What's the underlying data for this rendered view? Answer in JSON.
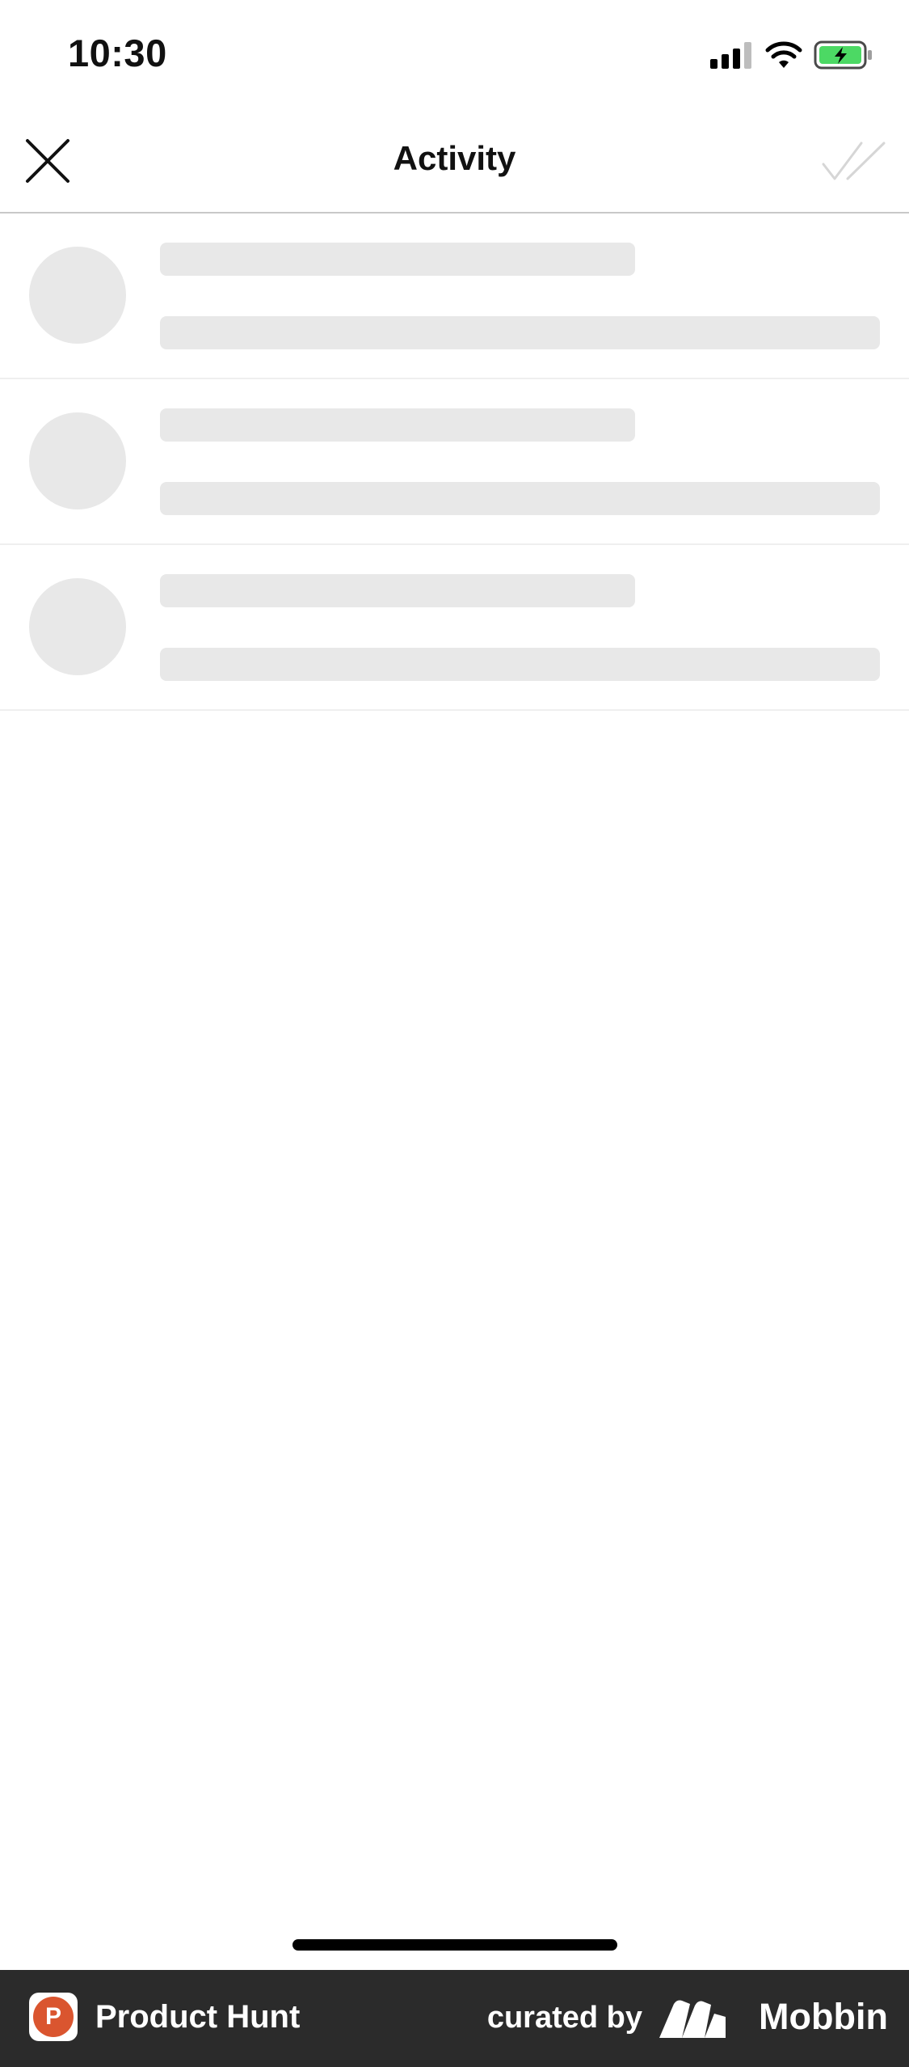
{
  "status_bar": {
    "time": "10:30",
    "icons": [
      "cellular-signal-icon",
      "wifi-icon",
      "battery-charging-icon"
    ],
    "battery_color": "#4cd964"
  },
  "header": {
    "title": "Activity",
    "close_icon": "close-icon",
    "mark_read_icon": "double-check-icon"
  },
  "list": {
    "loading_rows": 3,
    "placeholder_color": "#e8e8e8"
  },
  "footer": {
    "brand": "Product Hunt",
    "brand_logo_letter": "P",
    "brand_color": "#da552f",
    "curated_label": "curated by",
    "curator": "Mobbin",
    "background": "#2b2b2b"
  }
}
